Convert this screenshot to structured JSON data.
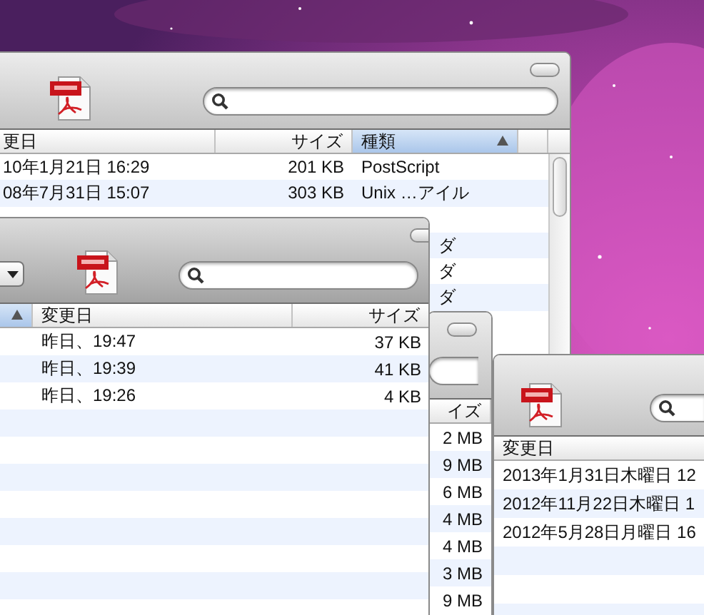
{
  "windows": [
    {
      "toolbar": [
        {
          "kind": "pdf"
        },
        {
          "kind": "search"
        }
      ],
      "columns": [
        {
          "label": "更日",
          "sorted": false
        },
        {
          "label": "サイズ",
          "sorted": false
        },
        {
          "label": "種類",
          "sorted": true
        },
        {
          "sorted": false
        }
      ],
      "rows": [
        {
          "cells": [
            "10年1月21日 16:29",
            "201 KB",
            "PostScript"
          ],
          "covered": false
        },
        {
          "cells": [
            "08年7月31日 15:07",
            "303 KB",
            "Unix …アイル"
          ],
          "covered": false
        },
        {
          "cells": [
            "ダ"
          ],
          "covered": true
        },
        {
          "cells": [
            "ダ"
          ],
          "covered": true
        },
        {
          "cells": [
            "ダ"
          ],
          "covered": true
        }
      ]
    },
    {
      "toolbar": [
        {
          "kind": "popup"
        },
        {
          "kind": "pdf"
        },
        {
          "kind": "search"
        }
      ],
      "columns": [
        {
          "sorted": true
        },
        {
          "label": "変更日",
          "sorted": false
        },
        {
          "label": "サイズ",
          "sorted": false
        }
      ],
      "rows": [
        {
          "cells": [
            "",
            "昨日、19:47",
            "37 KB"
          ],
          "covered": false
        },
        {
          "cells": [
            "",
            "昨日、19:39",
            "41 KB"
          ],
          "covered": false
        },
        {
          "cells": [
            "",
            "昨日、19:26",
            "4 KB"
          ],
          "covered": false
        }
      ]
    },
    {
      "toolbar": [
        {
          "kind": "search"
        }
      ],
      "columns": [
        {
          "label": "イズ",
          "sorted": false
        }
      ],
      "rows": [
        {
          "cells": [
            "2 MB"
          ],
          "covered": false
        },
        {
          "cells": [
            "9 MB"
          ],
          "covered": false
        },
        {
          "cells": [
            "6 MB"
          ],
          "covered": false
        },
        {
          "cells": [
            "4 MB"
          ],
          "covered": false
        },
        {
          "cells": [
            "4 MB"
          ],
          "covered": false
        },
        {
          "cells": [
            "3 MB"
          ],
          "covered": false
        },
        {
          "cells": [
            "9 MB"
          ],
          "covered": false
        }
      ]
    },
    {
      "toolbar": [
        {
          "kind": "pdf"
        },
        {
          "kind": "search"
        }
      ],
      "columns": [
        {
          "label": "変更日",
          "sorted": false
        }
      ],
      "rows": [
        {
          "cells": [
            "2013年1月31日木曜日 12"
          ],
          "covered": false
        },
        {
          "cells": [
            "2012年11月22日木曜日 1"
          ],
          "covered": false
        },
        {
          "cells": [
            "2012年5月28日月曜日 16"
          ],
          "covered": false
        }
      ]
    }
  ]
}
